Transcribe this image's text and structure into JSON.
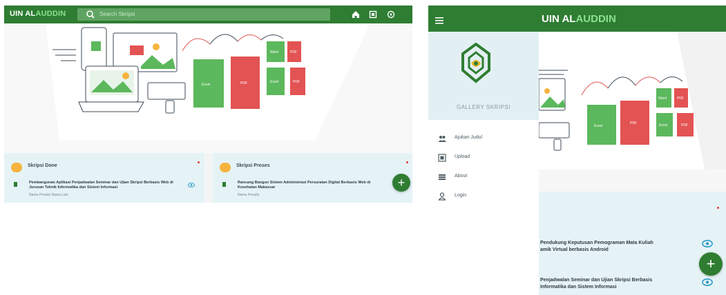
{
  "left_screen": {
    "brand_prefix": "UIN AL",
    "brand_accent": "AUDDIN",
    "search_placeholder": "Search Skripsi",
    "hero": {
      "card_labels": [
        "Excel",
        "PDF",
        "Word",
        "PDF",
        "Excel",
        "PDF"
      ]
    },
    "cards": [
      {
        "title": "Skripsi Done",
        "item_text": "Pembangunan Aplikasi Penjadwalan Seminar dan Ujian Skripsi Berbasis Web di Jurusan Teknik Informatika dan Sistem Informasi",
        "item_sub": "Nama Penulis Nama Lain"
      },
      {
        "title": "Skripsi Proses",
        "item_text": "Rancang Bangun Sistem Administrasi Persuratan Digital Berbasis Web di Kesehatan Makassar",
        "item_sub": "Nama Penulis"
      }
    ],
    "fab_label": "+"
  },
  "right_screen": {
    "brand_prefix": "UIN AL",
    "brand_accent": "AUDDIN",
    "drawer": {
      "subtitle": "GALLERY SKRIPSI",
      "items": [
        {
          "label": "Ajukan Judul",
          "icon": "people-icon"
        },
        {
          "label": "Upload",
          "icon": "upload-icon"
        },
        {
          "label": "About",
          "icon": "list-icon"
        },
        {
          "label": "Login",
          "icon": "user-icon"
        }
      ]
    },
    "hero": {
      "card_labels": [
        "Excel",
        "PDF",
        "Word",
        "PDF",
        "Excel",
        "PDF"
      ]
    },
    "list_items": [
      {
        "text_line1": "Pendukung Keputusan Pemograman Mata Kuliah",
        "text_line2": "amik Virtual berbasis Android"
      },
      {
        "text_line1": "Penjadwalan Seminar dan Ujian Skripsi Berbasis",
        "text_line2": "Informatika dan Sistem Informasi"
      }
    ],
    "fab_label": "+"
  },
  "colors": {
    "primary": "#2e7d32",
    "accent": "#8be28f",
    "excel_green": "#5cb85c",
    "pdf_red": "#e35353",
    "card_bg": "#e5f3f7"
  }
}
